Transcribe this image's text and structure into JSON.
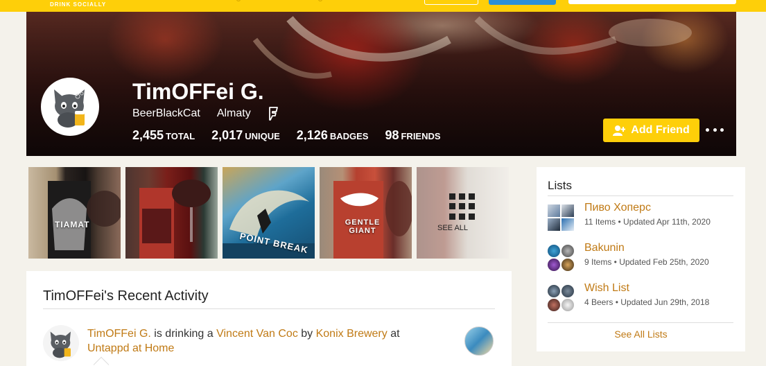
{
  "topbar": {
    "logo_tagline": "DRINK SOCIALLY",
    "accent_color": "#fecf09",
    "blue_button_color": "#2b8fd7"
  },
  "profile": {
    "name": "TimOFFei G.",
    "username": "BeerBlackCat",
    "location": "Almaty",
    "stats": [
      {
        "value": "2,455",
        "label": "TOTAL"
      },
      {
        "value": "2,017",
        "label": "UNIQUE"
      },
      {
        "value": "2,126",
        "label": "BADGES"
      },
      {
        "value": "98",
        "label": "FRIENDS"
      }
    ],
    "add_friend_label": "Add Friend",
    "more_icon": "more-dots-icon",
    "foursquare_icon": "foursquare-icon"
  },
  "photos": {
    "items": [
      {
        "label": "TIAMAT"
      },
      {
        "label": ""
      },
      {
        "label": "POINT BREAK"
      },
      {
        "label": "GENTLE GIANT"
      }
    ],
    "see_all_label": "SEE ALL"
  },
  "activity": {
    "title": "TimOFFei's Recent Activity",
    "items": [
      {
        "user": "TimOFFei G.",
        "verb1": " is drinking a ",
        "beer": "Vincent Van Coc",
        "verb2": " by ",
        "brewery": "Konix Brewery",
        "verb3": " at ",
        "venue": "Untappd at Home"
      }
    ]
  },
  "lists": {
    "title": "Lists",
    "items": [
      {
        "name": "Пиво Хоперс",
        "meta": "11 Items • Updated Apr 11th, 2020"
      },
      {
        "name": "Bakunin",
        "meta": "9 Items • Updated Feb 25th, 2020"
      },
      {
        "name": "Wish List",
        "meta": "4 Beers • Updated Jun 29th, 2018"
      }
    ],
    "see_all_label": "See All Lists",
    "link_color": "#c07a15"
  }
}
